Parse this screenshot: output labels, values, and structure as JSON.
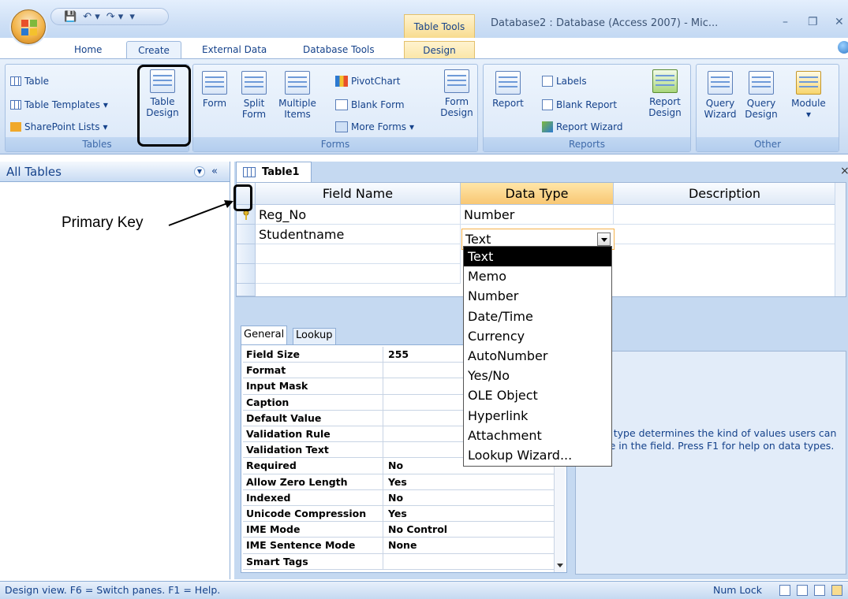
{
  "titlebar": {
    "table_tools": "Table Tools",
    "app_title": "Database2 : Database (Access 2007) - Mic...",
    "qat_items": [
      "💾",
      "↶ ▾",
      "↷ ▾",
      "▾"
    ]
  },
  "tabs": [
    "Home",
    "Create",
    "External Data",
    "Database Tools",
    "Design"
  ],
  "ribbon": {
    "tables": {
      "label": "Tables",
      "table": "Table",
      "table_templates": "Table Templates",
      "sharepoint_lists": "SharePoint Lists",
      "table_design_1": "Table",
      "table_design_2": "Design"
    },
    "forms": {
      "label": "Forms",
      "form": "Form",
      "split_1": "Split",
      "split_2": "Form",
      "multiple_1": "Multiple",
      "multiple_2": "Items",
      "pivotchart": "PivotChart",
      "blank_form": "Blank Form",
      "more_forms": "More Forms",
      "form_design_1": "Form",
      "form_design_2": "Design"
    },
    "reports": {
      "label": "Reports",
      "report": "Report",
      "labels": "Labels",
      "blank_report": "Blank Report",
      "report_wizard": "Report Wizard",
      "report_design_1": "Report",
      "report_design_2": "Design"
    },
    "other": {
      "label": "Other",
      "query_wizard_1": "Query",
      "query_wizard_2": "Wizard",
      "query_design_1": "Query",
      "query_design_2": "Design",
      "module": "Module"
    }
  },
  "nav": {
    "title": "All Tables",
    "collapse": "«"
  },
  "annotation": {
    "primary_key": "Primary Key"
  },
  "document": {
    "tab": "Table1",
    "close": "×",
    "columns": [
      "Field Name",
      "Data Type",
      "Description"
    ],
    "rows": [
      {
        "field": "Reg_No",
        "type": "Number",
        "description": ""
      },
      {
        "field": "Studentname",
        "type": "Text",
        "description": ""
      }
    ],
    "combo_value": "Text"
  },
  "dropdown": {
    "options": [
      "Text",
      "Memo",
      "Number",
      "Date/Time",
      "Currency",
      "AutoNumber",
      "Yes/No",
      "OLE Object",
      "Hyperlink",
      "Attachment",
      "Lookup Wizard..."
    ],
    "selected": "Text"
  },
  "properties": {
    "tabs": [
      "General",
      "Lookup"
    ],
    "rows": [
      {
        "name": "Field Size",
        "value": "255"
      },
      {
        "name": "Format",
        "value": ""
      },
      {
        "name": "Input Mask",
        "value": ""
      },
      {
        "name": "Caption",
        "value": ""
      },
      {
        "name": "Default Value",
        "value": ""
      },
      {
        "name": "Validation Rule",
        "value": ""
      },
      {
        "name": "Validation Text",
        "value": ""
      },
      {
        "name": "Required",
        "value": "No"
      },
      {
        "name": "Allow Zero Length",
        "value": "Yes"
      },
      {
        "name": "Indexed",
        "value": "No"
      },
      {
        "name": "Unicode Compression",
        "value": "Yes"
      },
      {
        "name": "IME Mode",
        "value": "No Control"
      },
      {
        "name": "IME Sentence Mode",
        "value": "None"
      },
      {
        "name": "Smart Tags",
        "value": ""
      }
    ],
    "help_text": "data type determines the kind of values users can store in the field.  Press F1 for help on data types."
  },
  "status": {
    "left": "Design view.  F6 = Switch panes.  F1 = Help.",
    "num_lock": "Num Lock"
  },
  "colors": {
    "ribbon_blue": "#d5e4f6",
    "contextual_yellow": "#f8dc8f",
    "selection_orange": "#f8c774"
  }
}
